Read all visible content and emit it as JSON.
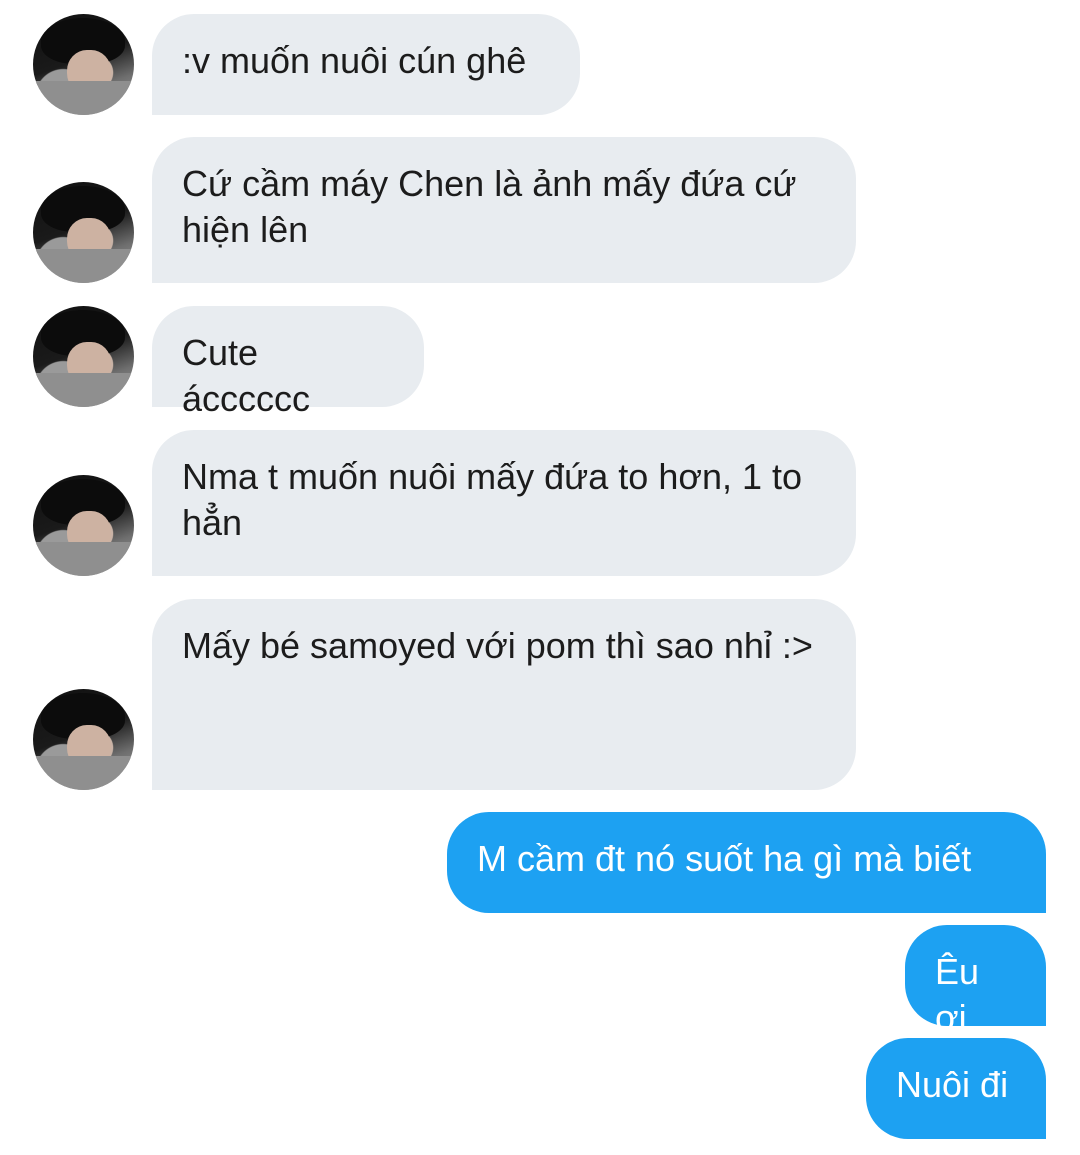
{
  "thread": {
    "incoming": [
      {
        "text": ":v muốn nuôi cún ghê"
      },
      {
        "text": "Cứ cầm máy Chen là ảnh mấy đứa cứ hiện lên"
      },
      {
        "text": "Cute ácccccc"
      },
      {
        "text": "Nma t muốn nuôi mấy đứa to hơn, 1 to hẳn"
      },
      {
        "text": "Mấy bé samoyed với pom thì sao nhỉ :>"
      }
    ],
    "outgoing": [
      {
        "text": "M cầm đt nó suốt ha gì mà biết"
      },
      {
        "text": "Êu ơi"
      },
      {
        "text": "Nuôi đi"
      }
    ]
  },
  "colors": {
    "incoming_bubble": "#e8ecf0",
    "outgoing_bubble": "#1da1f2",
    "incoming_text": "#1c1c1c",
    "outgoing_text": "#ffffff"
  }
}
